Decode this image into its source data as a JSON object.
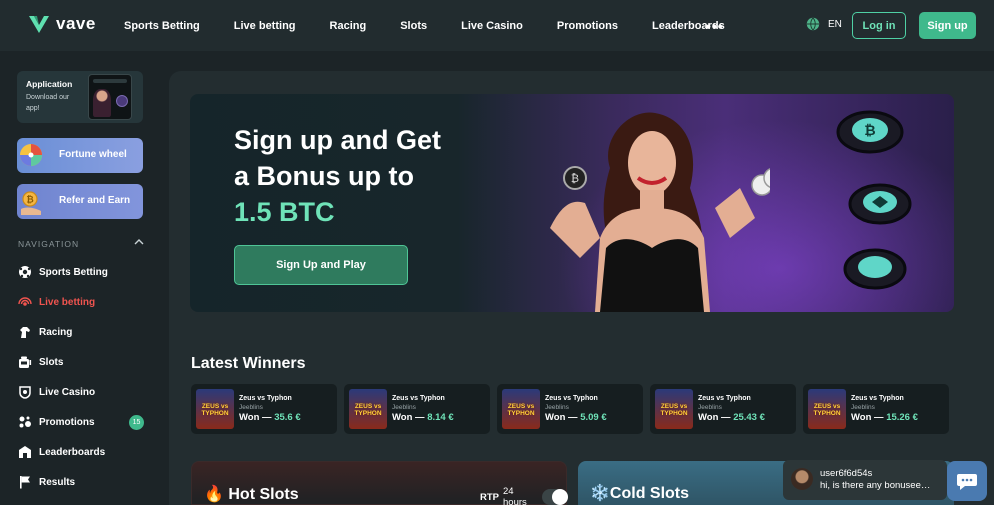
{
  "header": {
    "brand": "vave",
    "nav": [
      "Sports Betting",
      "Live betting",
      "Racing",
      "Slots",
      "Live Casino",
      "Promotions",
      "Leaderboards"
    ],
    "more": "•••",
    "language": "EN",
    "login_label": "Log in",
    "signup_label": "Sign up"
  },
  "sidebar": {
    "app_card": {
      "title": "Application",
      "subtitle": "Download our app!"
    },
    "fortune_wheel": "Fortune wheel",
    "refer_earn": "Refer and Earn",
    "nav_heading": "NAVIGATION",
    "items": [
      {
        "label": "Sports Betting",
        "icon": "soccer-ball-icon"
      },
      {
        "label": "Live betting",
        "icon": "live-signal-icon",
        "active": true
      },
      {
        "label": "Racing",
        "icon": "horse-icon"
      },
      {
        "label": "Slots",
        "icon": "slot-machine-icon"
      },
      {
        "label": "Live Casino",
        "icon": "chip-icon"
      },
      {
        "label": "Promotions",
        "icon": "gift-icon",
        "badge": "15"
      },
      {
        "label": "Leaderboards",
        "icon": "trophy-icon"
      },
      {
        "label": "Results",
        "icon": "flag-icon"
      }
    ]
  },
  "hero": {
    "line1": "Sign up and Get",
    "line2": "a Bonus up to",
    "amount": "1.5 BTC",
    "cta": "Sign Up and Play"
  },
  "winners": {
    "title": "Latest Winners",
    "thumb_text": "ZEUS vs TYPHON",
    "won_prefix": "Won —",
    "items": [
      {
        "game": "Zeus vs Typhon",
        "user": "Jeeblins",
        "amount": "35.6 €"
      },
      {
        "game": "Zeus vs Typhon",
        "user": "Jeeblins",
        "amount": "8.14 €"
      },
      {
        "game": "Zeus vs Typhon",
        "user": "Jeeblins",
        "amount": "5.09 €"
      },
      {
        "game": "Zeus vs Typhon",
        "user": "Jeeblins",
        "amount": "25.43 €"
      },
      {
        "game": "Zeus vs Typhon",
        "user": "Jeeblins",
        "amount": "15.26 €"
      }
    ]
  },
  "hot_slots": {
    "title": "🔥 Hot Slots",
    "rtp_label": "RTP",
    "rtp_period": "24 hours"
  },
  "cold_slots": {
    "title": "❄️Cold Slots"
  },
  "chat": {
    "user": "user6f6d54s",
    "message": "hi, is there any bonusee…"
  },
  "colors": {
    "accent": "#3fb98c",
    "active": "#f0544f",
    "bg": "#1c2427"
  }
}
